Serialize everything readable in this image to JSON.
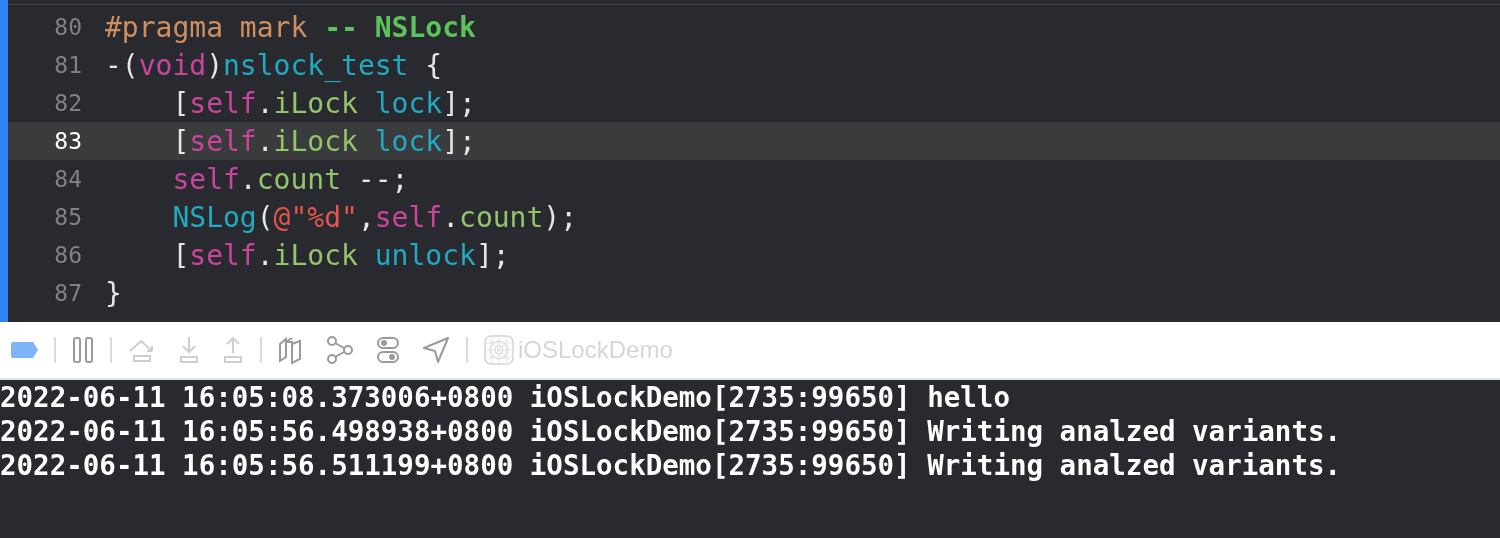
{
  "editor": {
    "lines": [
      {
        "number": "80",
        "selected": false,
        "tokens": [
          {
            "kind": "directive",
            "text": "#pragma mark "
          },
          {
            "kind": "mark",
            "text": "-- NSLock"
          }
        ]
      },
      {
        "number": "81",
        "selected": false,
        "tokens": [
          {
            "kind": "plain",
            "text": "-("
          },
          {
            "kind": "keyword",
            "text": "void"
          },
          {
            "kind": "plain",
            "text": ")"
          },
          {
            "kind": "method",
            "text": "nslock_test"
          },
          {
            "kind": "plain",
            "text": " {"
          }
        ]
      },
      {
        "number": "82",
        "selected": false,
        "tokens": [
          {
            "kind": "plain",
            "text": "    ["
          },
          {
            "kind": "keyword",
            "text": "self"
          },
          {
            "kind": "plain",
            "text": "."
          },
          {
            "kind": "property",
            "text": "iLock"
          },
          {
            "kind": "method",
            "text": " lock"
          },
          {
            "kind": "plain",
            "text": "];"
          }
        ]
      },
      {
        "number": "83",
        "selected": true,
        "tokens": [
          {
            "kind": "plain",
            "text": "    ["
          },
          {
            "kind": "keyword",
            "text": "self"
          },
          {
            "kind": "plain",
            "text": "."
          },
          {
            "kind": "property",
            "text": "iLock"
          },
          {
            "kind": "method",
            "text": " lock"
          },
          {
            "kind": "plain",
            "text": "];"
          }
        ]
      },
      {
        "number": "84",
        "selected": false,
        "tokens": [
          {
            "kind": "keyword",
            "text": "    self"
          },
          {
            "kind": "plain",
            "text": "."
          },
          {
            "kind": "property",
            "text": "count"
          },
          {
            "kind": "plain",
            "text": " --;"
          }
        ]
      },
      {
        "number": "85",
        "selected": false,
        "tokens": [
          {
            "kind": "method",
            "text": "    NSLog"
          },
          {
            "kind": "plain",
            "text": "("
          },
          {
            "kind": "string",
            "text": "@\"%d\""
          },
          {
            "kind": "plain",
            "text": ","
          },
          {
            "kind": "keyword",
            "text": "self"
          },
          {
            "kind": "plain",
            "text": "."
          },
          {
            "kind": "property",
            "text": "count"
          },
          {
            "kind": "plain",
            "text": ");"
          }
        ]
      },
      {
        "number": "86",
        "selected": false,
        "tokens": [
          {
            "kind": "plain",
            "text": "    ["
          },
          {
            "kind": "keyword",
            "text": "self"
          },
          {
            "kind": "plain",
            "text": "."
          },
          {
            "kind": "property",
            "text": "iLock"
          },
          {
            "kind": "method",
            "text": " unlock"
          },
          {
            "kind": "plain",
            "text": "];"
          }
        ]
      },
      {
        "number": "87",
        "selected": false,
        "tokens": [
          {
            "kind": "plain",
            "text": "}"
          }
        ]
      }
    ]
  },
  "debug_bar": {
    "process": "iOSLockDemo"
  },
  "console": {
    "lines": [
      "2022-06-11 16:05:08.373006+0800 iOSLockDemo[2735:99650] hello",
      "2022-06-11 16:05:56.498938+0800 iOSLockDemo[2735:99650] Writing analzed variants.",
      "2022-06-11 16:05:56.511199+0800 iOSLockDemo[2735:99650] Writing analzed variants."
    ]
  }
}
